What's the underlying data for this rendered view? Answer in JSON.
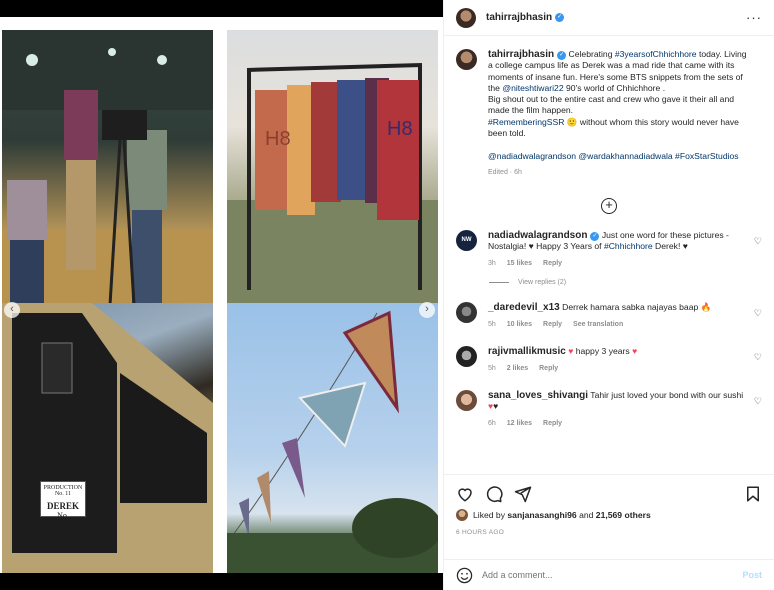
{
  "post": {
    "username": "tahirrajbhasin",
    "caption": {
      "part1": "Celebrating ",
      "hashtag1": "#3yearsofChhichhore",
      "part2": " today. Living a college campus life as Derek was a mad ride that came with its moments of insane fun. Here's some BTS snippets from the sets of the ",
      "mention1": "@niteshtiwari22",
      "part3": " 90's world of Chhichhore .",
      "line2": "Big shout out to the entire cast and crew who gave it their all and made the film happen.",
      "hashtag2": "#RememberingSSR",
      "emoji": "🙂",
      "part4": " without whom this story would never have been told.",
      "mentions_line": "@nadiadwalagrandson @wardakhannadiadwala #FoxStarStudios"
    },
    "edited": "Edited · 6h"
  },
  "media": {
    "sheet_top": "PRODUCTION No. 11",
    "sheet_name": "DEREK",
    "sheet_sub": "No."
  },
  "comments": [
    {
      "username": "nadiadwalagrandson",
      "text": "Just one word for these pictures - Nostalgia! ♥ Happy 3 Years of ",
      "hashtag": "#Chhichhore",
      "tail": " Derek! ♥",
      "time": "3h",
      "likes": "15 likes",
      "reply": "Reply",
      "view_replies": "View replies (2)"
    },
    {
      "username": "_daredevil_x13",
      "text": "Derrek hamara sabka najayas baap 🔥",
      "time": "5h",
      "likes": "10 likes",
      "reply": "Reply",
      "translation": "See translation"
    },
    {
      "username": "rajivmallikmusic",
      "text": "happy 3 years",
      "time": "5h",
      "likes": "2 likes",
      "reply": "Reply"
    },
    {
      "username": "sana_loves_shivangi",
      "text": "Tahir just loved your bond with our sushi",
      "time": "6h",
      "likes": "12 likes",
      "reply": "Reply"
    }
  ],
  "footer": {
    "liked_prefix": "Liked by ",
    "liked_user": "sanjanasanghi96",
    "liked_and": " and ",
    "liked_count": "21,569 others",
    "ago": "6 HOURS AGO",
    "add_comment_placeholder": "Add a comment...",
    "post_label": "Post"
  },
  "icons": [
    "more-icon",
    "heart-icon",
    "comment-icon",
    "share-icon",
    "save-icon",
    "emoji-icon",
    "plus-circle-icon",
    "verified-icon"
  ],
  "colors": {
    "link": "#00376b",
    "verified": "#3897f0",
    "post_disabled": "#b2dffc",
    "meta": "#8e8e8e"
  }
}
